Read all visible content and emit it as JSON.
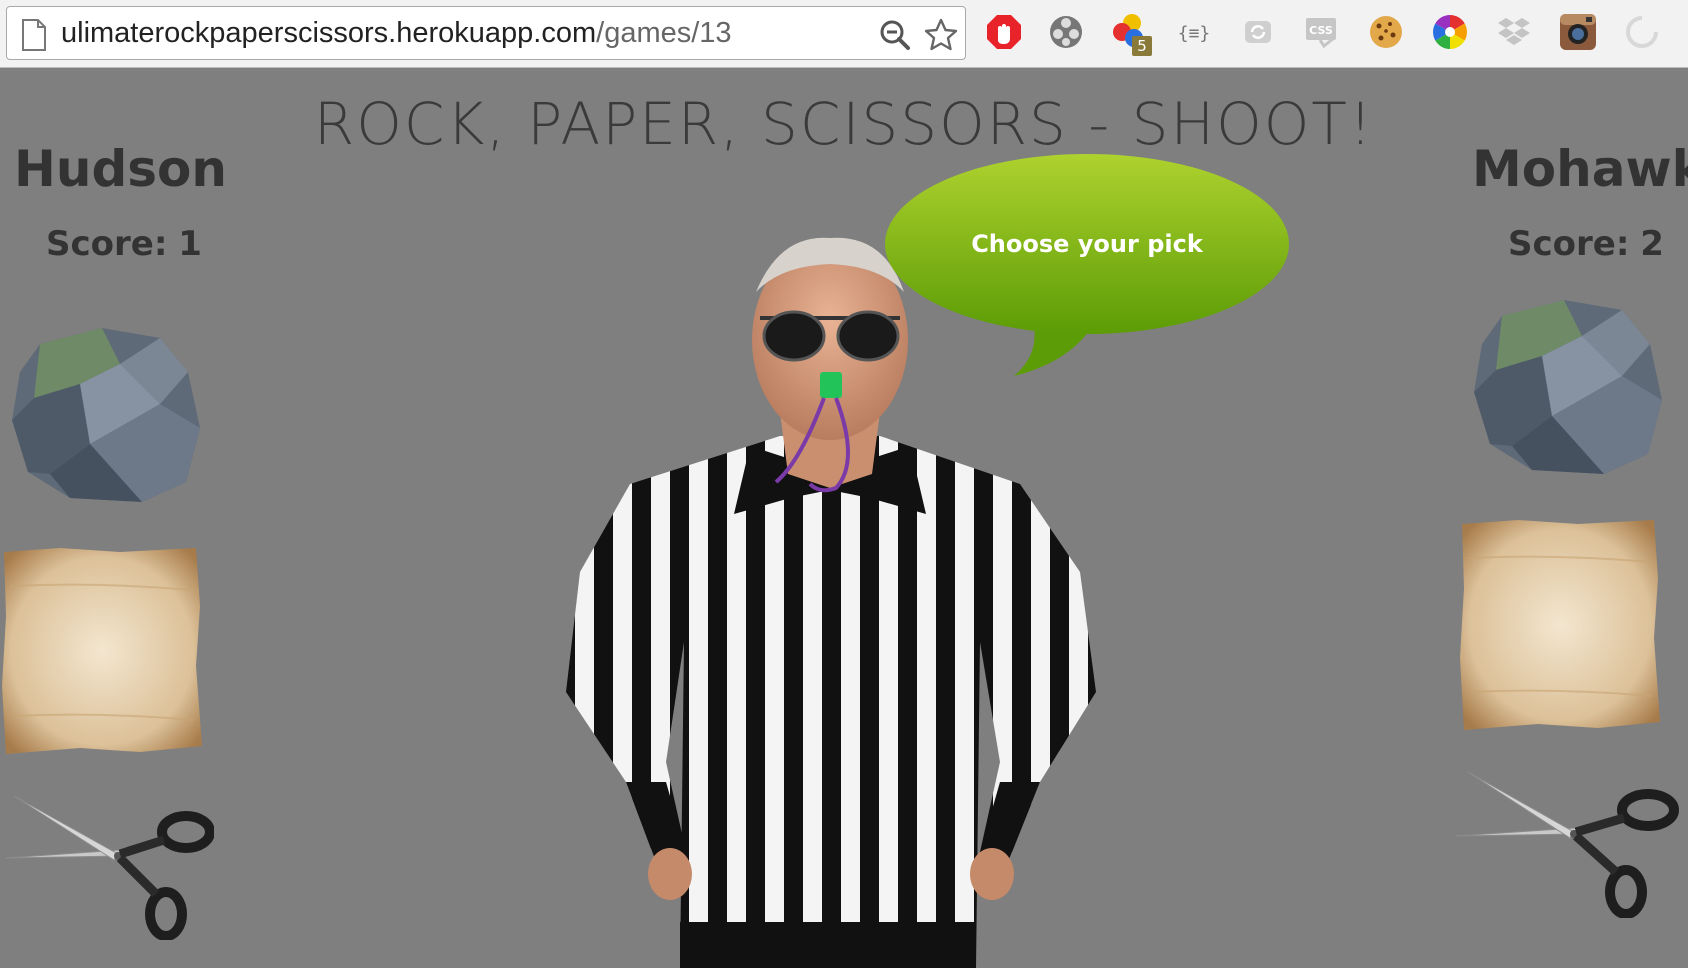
{
  "browser": {
    "url_host": "ulimaterockpaperscissors.herokuapp.com",
    "url_path": "/games/13",
    "extensions": [
      "adblock-icon",
      "film-icon",
      "color-dots-icon",
      "json-icon",
      "refresh-icon",
      "css-icon",
      "cookie-icon",
      "color-wheel-icon",
      "dropbox-icon",
      "instagram-icon",
      "circle-icon"
    ],
    "badge_count": "5"
  },
  "page": {
    "title": "ROCK, PAPER, SCISSORS - SHOOT!",
    "speech_bubble": "Choose your pick",
    "players": {
      "left": {
        "name": "Hudson",
        "score_label": "Score:",
        "score_value": "1"
      },
      "right": {
        "name": "Mohawk",
        "score_label": "Score:",
        "score_value": "2"
      }
    },
    "picks": [
      "rock",
      "paper",
      "scissors"
    ]
  },
  "colors": {
    "background": "#7f7f7f",
    "bubble_top": "#aed22e",
    "bubble_bottom": "#5c9c06",
    "text": "#333333"
  }
}
